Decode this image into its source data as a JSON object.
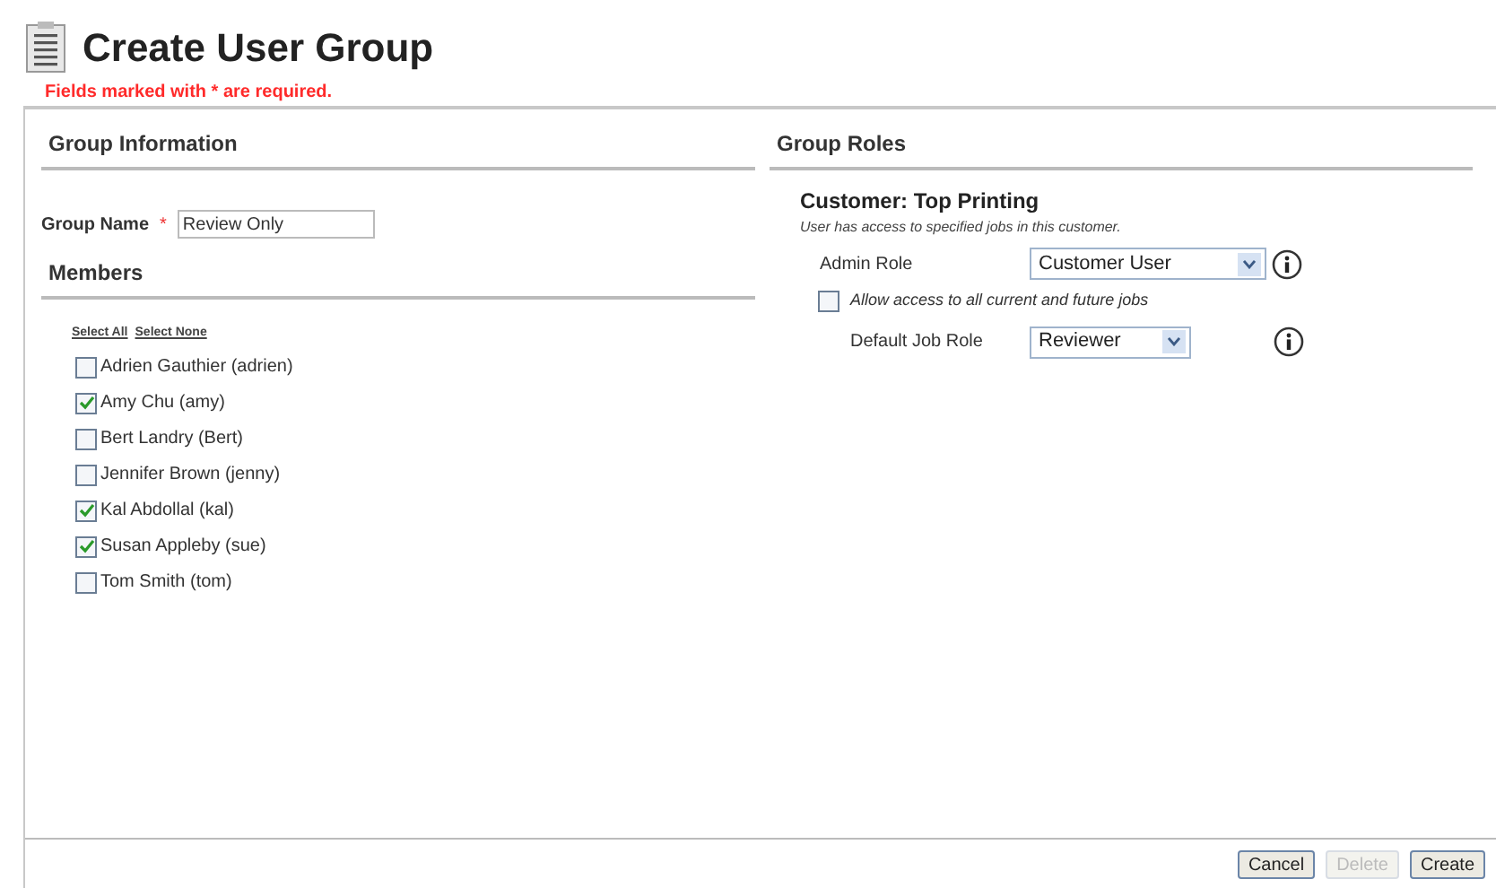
{
  "title": "Create User Group",
  "required_note": "Fields marked with * are required.",
  "group_information": {
    "heading": "Group Information",
    "group_name": {
      "label": "Group Name",
      "required_mark": "*",
      "value": "Review Only"
    }
  },
  "members": {
    "heading": "Members",
    "select_all": "Select All",
    "select_none": "Select None",
    "items": [
      {
        "label": "Adrien Gauthier (adrien)",
        "checked": false
      },
      {
        "label": "Amy Chu (amy)",
        "checked": true
      },
      {
        "label": "Bert Landry (Bert)",
        "checked": false
      },
      {
        "label": "Jennifer Brown (jenny)",
        "checked": false
      },
      {
        "label": "Kal Abdollal (kal)",
        "checked": true
      },
      {
        "label": "Susan Appleby (sue)",
        "checked": true
      },
      {
        "label": "Tom Smith (tom)",
        "checked": false
      }
    ]
  },
  "group_roles": {
    "heading": "Group Roles",
    "customer": "Customer: Top Printing",
    "note": "User has access to specified jobs in this customer.",
    "admin_role": {
      "label": "Admin Role",
      "value": "Customer User"
    },
    "allow_all_jobs": {
      "label": "Allow access to all current and future jobs",
      "checked": false
    },
    "default_job_role": {
      "label": "Default Job Role",
      "value": "Reviewer"
    }
  },
  "buttons": [
    {
      "label": "Cancel",
      "disabled": false
    },
    {
      "label": "Delete",
      "disabled": true
    },
    {
      "label": "Create",
      "disabled": false
    }
  ]
}
